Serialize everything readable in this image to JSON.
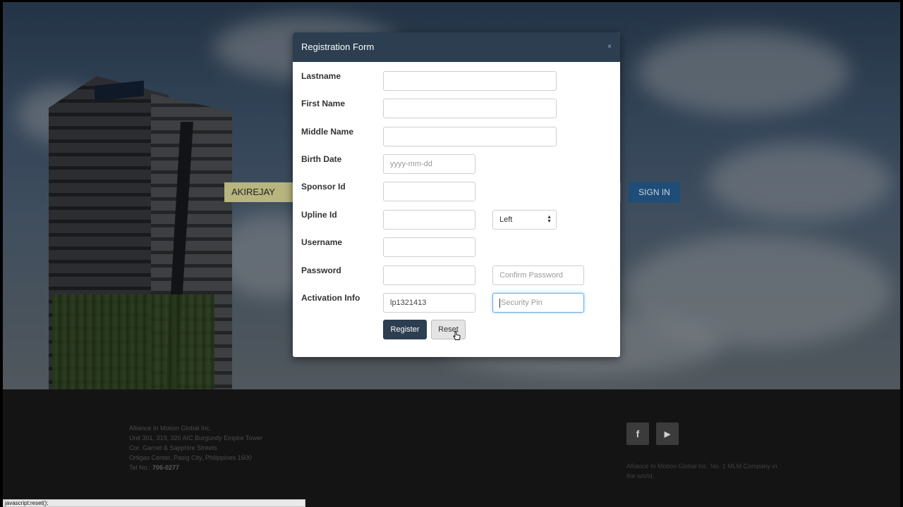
{
  "background": {
    "username_value": "AKIREJAY",
    "signin_label": "SIGN IN"
  },
  "modal": {
    "title": "Registration Form",
    "close_glyph": "×",
    "fields": {
      "lastname_label": "Lastname",
      "firstname_label": "First Name",
      "middlename_label": "Middle Name",
      "birthdate_label": "Birth Date",
      "birthdate_placeholder": "yyyy-mm-dd",
      "sponsor_label": "Sponsor Id",
      "upline_label": "Upline Id",
      "position_selected": "Left",
      "username_label": "Username",
      "password_label": "Password",
      "confirm_password_placeholder": "Confirm Password",
      "activation_label": "Activation Info",
      "activation_value": "lp1321413",
      "security_pin_placeholder": "Security Pin"
    },
    "register_label": "Register",
    "reset_label": "Reset"
  },
  "footer": {
    "address_lines": [
      "Alliance In Motion Global Inc.",
      "Unit 301, 319, 320 AIC Burgundy Empire Tower",
      "Cor. Garnet & Sapphire Streets",
      "Ortigas Center, Pasig City, Philippines 1600"
    ],
    "tel_label": "Tel No.:",
    "tel_value": "706-0277",
    "facebook_glyph": "f",
    "youtube_glyph": "▶",
    "tagline": "Alliance In Motion Global Inc. No. 1 MLM Company in the world."
  },
  "statusbar": {
    "text": "javascript:reset();"
  },
  "colors": {
    "modal_header": "#2c3e50",
    "register_button": "#2c3e50",
    "signin_button": "#1f4d77",
    "focus_border": "#66afe9"
  }
}
